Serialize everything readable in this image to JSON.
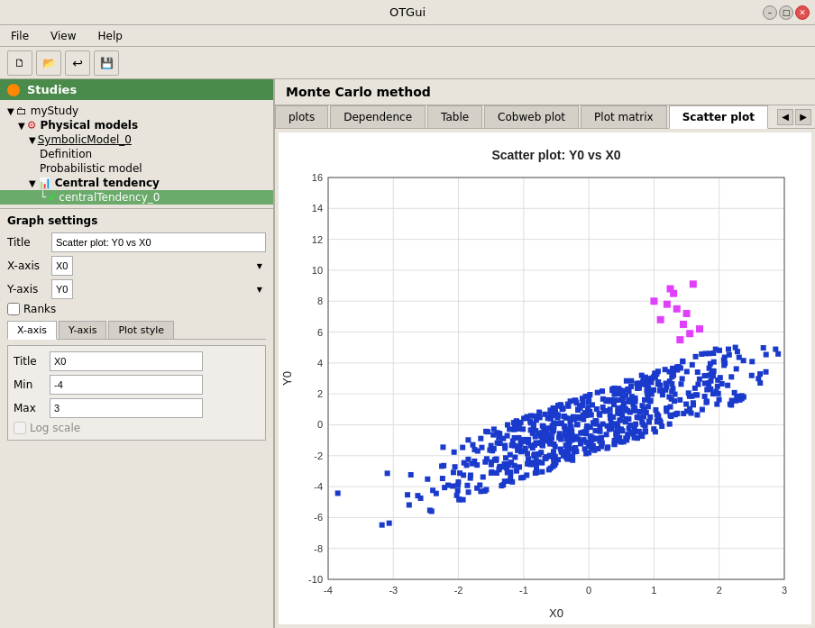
{
  "window": {
    "title": "OTGui"
  },
  "menubar": {
    "items": [
      {
        "label": "File",
        "id": "file"
      },
      {
        "label": "View",
        "id": "view"
      },
      {
        "label": "Help",
        "id": "help"
      }
    ]
  },
  "toolbar": {
    "buttons": [
      {
        "icon": "new-icon",
        "unicode": "🗋"
      },
      {
        "icon": "open-icon",
        "unicode": "📂"
      },
      {
        "icon": "undo-icon",
        "unicode": "↩"
      },
      {
        "icon": "save-icon",
        "unicode": "💾"
      }
    ]
  },
  "left_panel": {
    "studies_header": "Studies",
    "tree": [
      {
        "level": 1,
        "arrow": "▼",
        "icon": "📁",
        "label": "myStudy",
        "selected": false
      },
      {
        "level": 2,
        "arrow": "▼",
        "icon": "⚙",
        "label": "Physical models",
        "selected": false,
        "bold": true
      },
      {
        "level": 3,
        "arrow": "▼",
        "icon": "",
        "label": "SymbolicModel_0",
        "selected": false,
        "underline": true
      },
      {
        "level": 4,
        "arrow": "",
        "icon": "",
        "label": "Definition",
        "selected": false
      },
      {
        "level": 4,
        "arrow": "",
        "icon": "",
        "label": "Probabilistic model",
        "selected": false
      },
      {
        "level": 3,
        "arrow": "▼",
        "icon": "📊",
        "label": "Central tendency",
        "selected": false,
        "bold": true
      },
      {
        "level": 4,
        "arrow": "",
        "icon": "✓",
        "label": "centralTendency_0",
        "selected": true
      }
    ]
  },
  "graph_settings": {
    "title": "Graph settings",
    "title_label": "Title",
    "title_value": "Scatter plot: Y0 vs X0",
    "xaxis_label": "X-axis",
    "xaxis_value": "X0",
    "yaxis_label": "Y-axis",
    "yaxis_value": "Y0",
    "ranks_label": "Ranks",
    "ranks_checked": false,
    "sub_tabs": [
      {
        "label": "X-axis",
        "active": true
      },
      {
        "label": "Y-axis",
        "active": false
      },
      {
        "label": "Plot style",
        "active": false
      }
    ],
    "axis_form": {
      "title_label": "Title",
      "title_value": "X0",
      "min_label": "Min",
      "min_value": "-4",
      "max_label": "Max",
      "max_value": "3",
      "log_scale_label": "Log scale",
      "log_scale_checked": false
    }
  },
  "right_panel": {
    "header": "Monte Carlo method",
    "tabs": [
      {
        "label": "plots",
        "active": false
      },
      {
        "label": "Dependence",
        "active": false
      },
      {
        "label": "Table",
        "active": false
      },
      {
        "label": "Cobweb plot",
        "active": false
      },
      {
        "label": "Plot matrix",
        "active": false
      },
      {
        "label": "Scatter plot",
        "active": true
      }
    ],
    "chart": {
      "title": "Scatter plot: Y0 vs X0",
      "xlabel": "X0",
      "ylabel": "Y0",
      "xmin": -4,
      "xmax": 3,
      "ymin": -10,
      "ymax": 16,
      "xticks": [
        -4,
        -3,
        -2,
        -1,
        0,
        1,
        2,
        3
      ],
      "yticks": [
        -10,
        -8,
        -6,
        -4,
        -2,
        0,
        2,
        4,
        6,
        8,
        10,
        12,
        14,
        16
      ],
      "accent_color": "#e040fb",
      "main_color": "#1a3acc"
    }
  }
}
